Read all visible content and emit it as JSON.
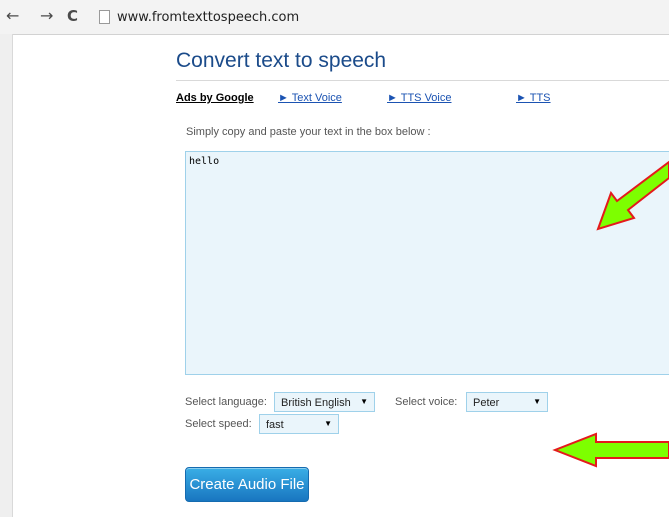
{
  "browser": {
    "back_glyph": "←",
    "forward_glyph": "→",
    "reload_glyph": "C",
    "url": "www.fromtexttospeech.com"
  },
  "page": {
    "title": "Convert text to speech",
    "ads_label": "Ads by Google",
    "ad_links": [
      "► Text Voice",
      "► TTS Voice",
      "► TTS"
    ],
    "instructions": "Simply copy and paste your text in the box below :",
    "text_content": "hello",
    "language_label": "Select language:",
    "language_value": "British English",
    "voice_label": "Select voice:",
    "voice_value": "Peter",
    "speed_label": "Select speed:",
    "speed_value": "fast",
    "create_button": "Create Audio File"
  },
  "annotations": {
    "arrow_color": "#7dff00",
    "arrow_outline": "#e41a1c"
  }
}
